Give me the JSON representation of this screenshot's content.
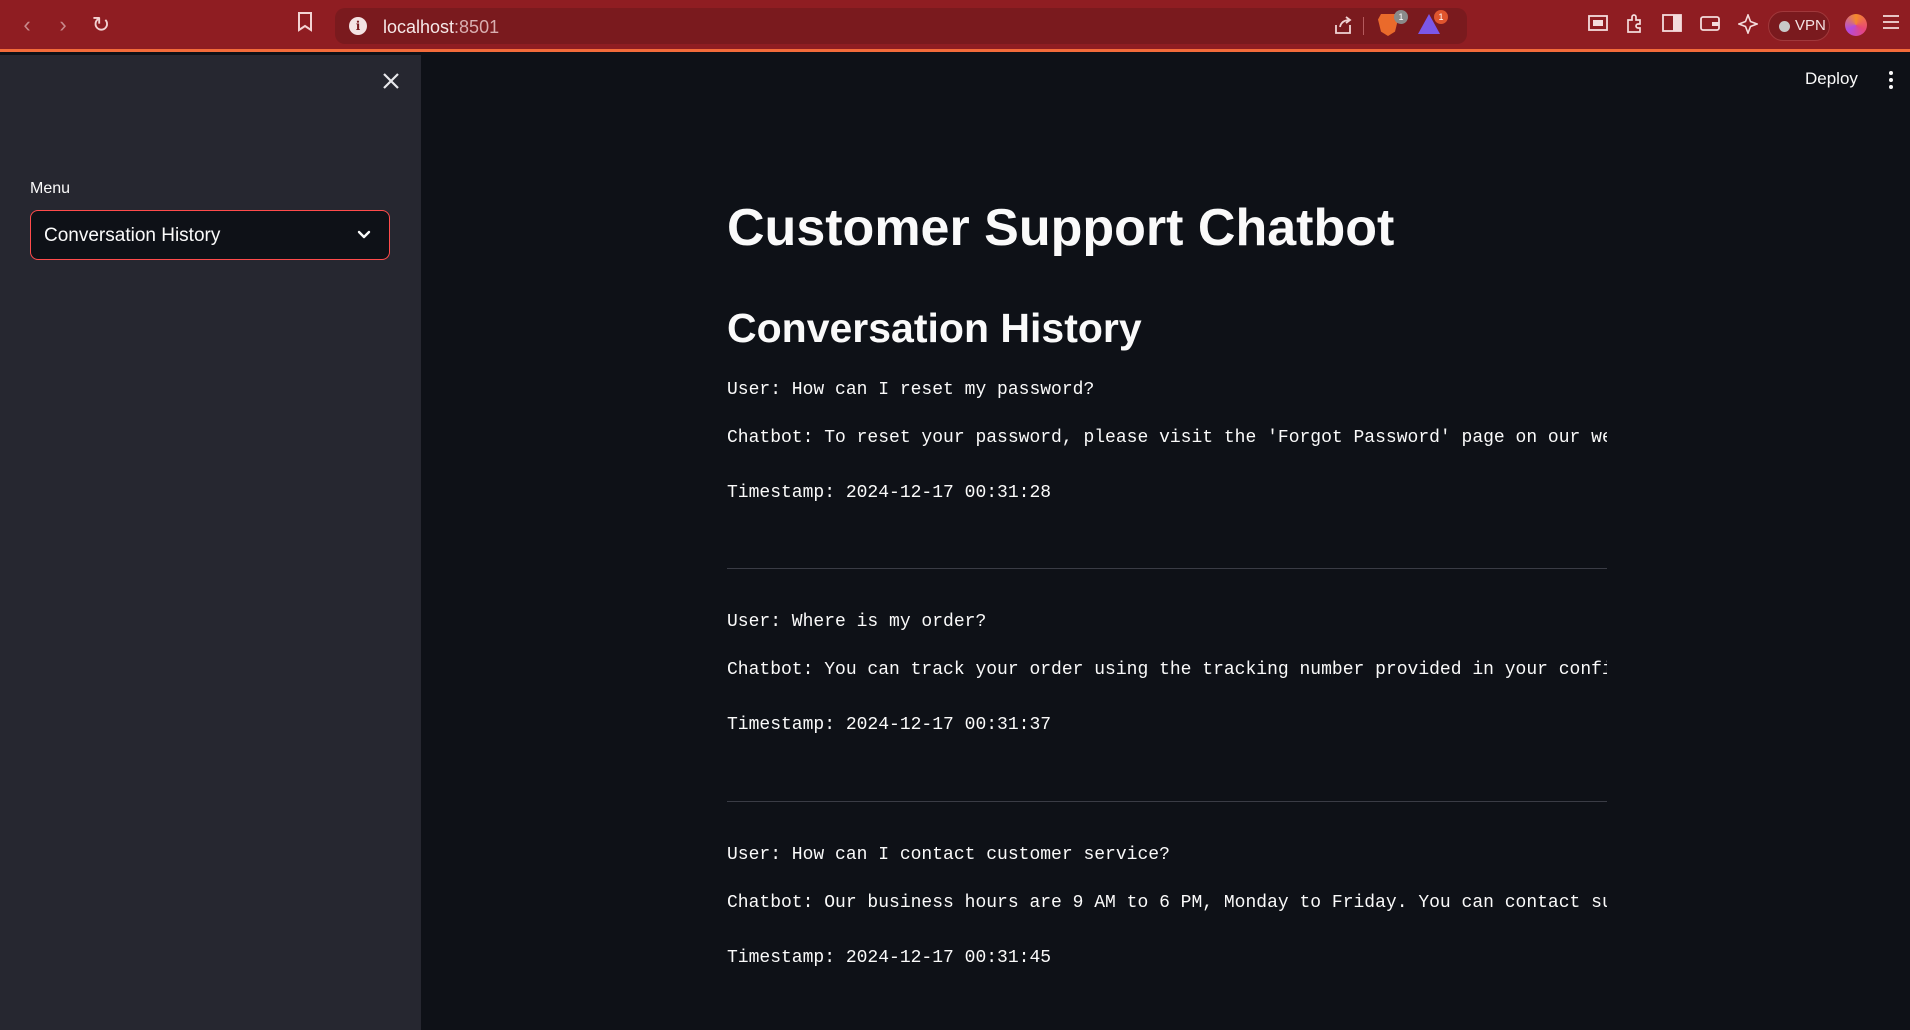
{
  "browser": {
    "url_host": "localhost",
    "url_port": ":8501",
    "brave_badge": "1",
    "rewards_badge": "1",
    "vpn_label": "VPN"
  },
  "sidebar": {
    "menu_label": "Menu",
    "menu_selected": "Conversation History"
  },
  "header": {
    "deploy_label": "Deploy"
  },
  "main": {
    "title": "Customer Support Chatbot",
    "section_title": "Conversation History",
    "conversations": [
      {
        "user": "User: How can I reset my password?",
        "bot": "Chatbot: To reset your password, please visit the 'Forgot Password' page on our webs",
        "timestamp": "Timestamp: 2024-12-17 00:31:28"
      },
      {
        "user": "User: Where is my order?",
        "bot": "Chatbot: You can track your order using the tracking number provided in your confirm",
        "timestamp": "Timestamp: 2024-12-17 00:31:37"
      },
      {
        "user": "User: How can I contact customer service?",
        "bot": "Chatbot: Our business hours are 9 AM to 6 PM, Monday to Friday. You can contact supp",
        "timestamp": "Timestamp: 2024-12-17 00:31:45"
      }
    ]
  },
  "colors": {
    "browser_bar": "#8f1d22",
    "sidebar_bg": "#262730",
    "main_bg": "#0e1117",
    "accent": "#ff4b4b"
  }
}
